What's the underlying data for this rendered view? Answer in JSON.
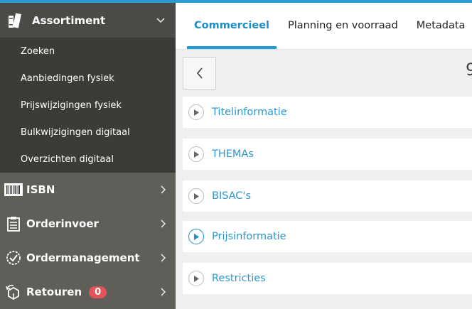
{
  "sidebar": {
    "header": {
      "label": "Assortiment",
      "icon": "books-icon"
    },
    "subitems": [
      "Zoeken",
      "Aanbiedingen fysiek",
      "Prijswijzigingen fysiek",
      "Bulkwijzigingen digitaal",
      "Overzichten digitaal"
    ],
    "nav": [
      {
        "label": "ISBN",
        "icon": "barcode-icon"
      },
      {
        "label": "Orderinvoer",
        "icon": "clipboard-icon"
      },
      {
        "label": "Ordermanagement",
        "icon": "check-circle-icon"
      },
      {
        "label": "Retouren",
        "icon": "return-box-icon",
        "badge": "0"
      }
    ]
  },
  "tabs": [
    "Commercieel",
    "Planning en voorraad",
    "Metadata"
  ],
  "toolbar": {
    "truncated_text": "9"
  },
  "panels": [
    "Titelinformatie",
    "THEMAs",
    "BISAC's",
    "Prijsinformatie",
    "Restricties"
  ],
  "colors": {
    "accent": "#1f8dcb",
    "sidebar": "#5f5e59",
    "submenu": "#3c3b38",
    "badge": "#e0545a"
  }
}
